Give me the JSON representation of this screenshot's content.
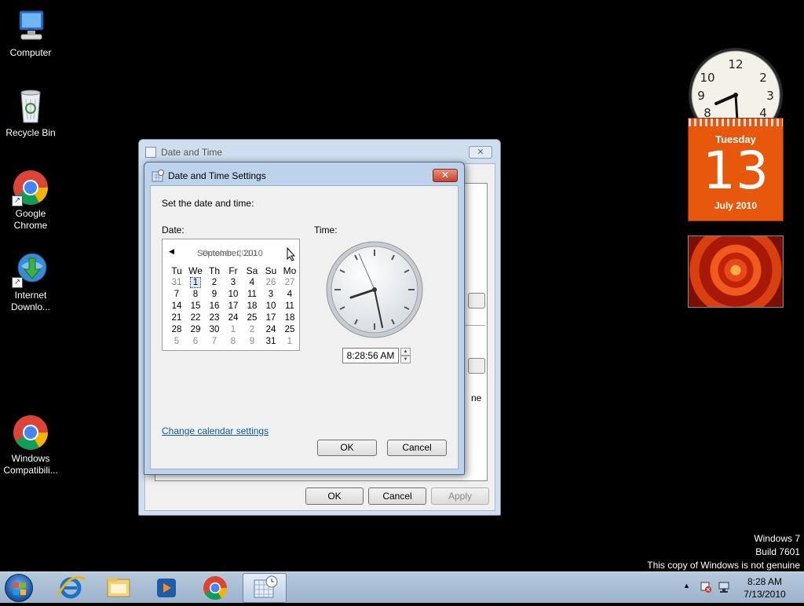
{
  "desktop": {
    "icons": [
      {
        "label": "Computer"
      },
      {
        "label": "Recycle Bin"
      },
      {
        "label": "Google Chrome"
      },
      {
        "label": "Internet Downlo..."
      },
      {
        "label": "Windows Compatibili..."
      }
    ]
  },
  "gadgets": {
    "calendar": {
      "weekday": "Tuesday",
      "day": "13",
      "month_year": "July 2010"
    }
  },
  "back_window": {
    "title": "Date and Time",
    "partial_text": "ne",
    "buttons": {
      "ok": "OK",
      "cancel": "Cancel",
      "apply": "Apply"
    }
  },
  "dialog": {
    "title": "Date and Time Settings",
    "instruction": "Set the date and time:",
    "date_label": "Date:",
    "time_label": "Time:",
    "calendar": {
      "month_text": "September, 2010",
      "overlay_month_text": "October, 2010",
      "weekday_headers": [
        "Tu",
        "We",
        "Th",
        "Fr",
        "Sa",
        "Su",
        "Mo"
      ],
      "rows": [
        [
          "31",
          "1",
          "2",
          "3",
          "4",
          "26",
          "27"
        ],
        [
          "7",
          "8",
          "9",
          "10",
          "11",
          "3",
          "4"
        ],
        [
          "14",
          "15",
          "16",
          "17",
          "18",
          "10",
          "11"
        ],
        [
          "21",
          "22",
          "23",
          "24",
          "25",
          "17",
          "18"
        ],
        [
          "28",
          "29",
          "30",
          "1",
          "2",
          "24",
          "25"
        ],
        [
          "5",
          "6",
          "7",
          "8",
          "9",
          "31",
          "1"
        ]
      ],
      "selected": "1"
    },
    "time_value": "8:28:56 AM",
    "change_calendar_link": "Change calendar settings",
    "buttons": {
      "ok": "OK",
      "cancel": "Cancel"
    }
  },
  "watermark": {
    "line1": "Windows 7",
    "line2": "Build 7601",
    "line3": "This copy of Windows is not genuine"
  },
  "taskbar": {
    "clock_time": "8:28 AM",
    "clock_date": "7/13/2010",
    "items": [
      "start-orb",
      "internet-explorer",
      "windows-explorer",
      "media-player",
      "google-chrome",
      "date-time-settings"
    ]
  }
}
